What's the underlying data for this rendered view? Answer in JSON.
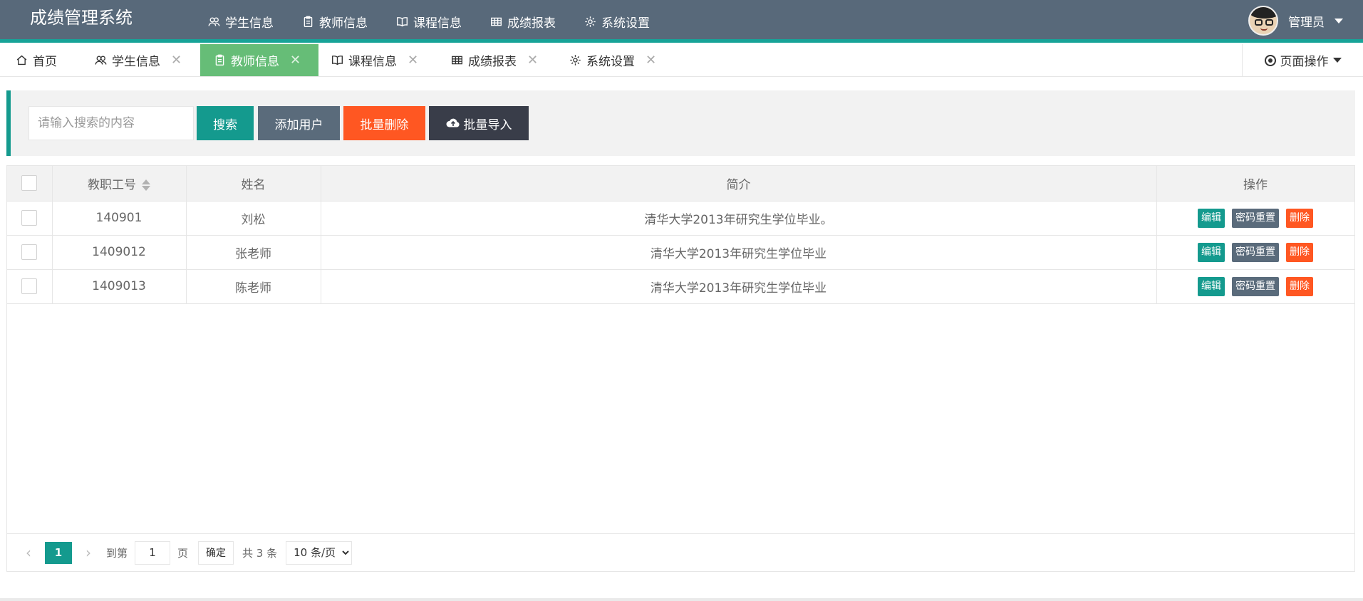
{
  "app": {
    "title": "成绩管理系统"
  },
  "topnav": [
    {
      "label": "学生信息",
      "icon": "users-icon"
    },
    {
      "label": "教师信息",
      "icon": "clipboard-icon"
    },
    {
      "label": "课程信息",
      "icon": "book-icon"
    },
    {
      "label": "成绩报表",
      "icon": "table-icon"
    },
    {
      "label": "系统设置",
      "icon": "gear-icon"
    }
  ],
  "user": {
    "name": "管理员"
  },
  "tabs": [
    {
      "label": "首页",
      "closable": false
    },
    {
      "label": "学生信息",
      "closable": true
    },
    {
      "label": "教师信息",
      "closable": true,
      "active": true
    },
    {
      "label": "课程信息",
      "closable": true
    },
    {
      "label": "成绩报表",
      "closable": true
    },
    {
      "label": "系统设置",
      "closable": true
    }
  ],
  "page_ops": {
    "label": "页面操作"
  },
  "toolbar": {
    "search_placeholder": "请输入搜索的内容",
    "search_label": "搜索",
    "add_label": "添加用户",
    "batch_delete_label": "批量删除",
    "batch_import_label": "批量导入"
  },
  "table": {
    "columns": [
      "教职工号",
      "姓名",
      "简介",
      "操作"
    ],
    "rows": [
      {
        "id": "140901",
        "name": "刘松",
        "intro": "清华大学2013年研究生学位毕业。"
      },
      {
        "id": "1409012",
        "name": "张老师",
        "intro": "清华大学2013年研究生学位毕业"
      },
      {
        "id": "1409013",
        "name": "陈老师",
        "intro": "清华大学2013年研究生学位毕业"
      }
    ],
    "actions": {
      "edit": "编辑",
      "reset": "密码重置",
      "delete": "删除"
    }
  },
  "pager": {
    "current": "1",
    "goto_label": "到第",
    "goto_value": "1",
    "page_unit": "页",
    "confirm_label": "确定",
    "total": "共 3 条",
    "page_size": "10 条/页"
  },
  "colors": {
    "header": "#58697a",
    "accent": "#149a8e",
    "active_tab": "#66bd77",
    "danger": "#ff5722",
    "dark": "#393d49"
  }
}
